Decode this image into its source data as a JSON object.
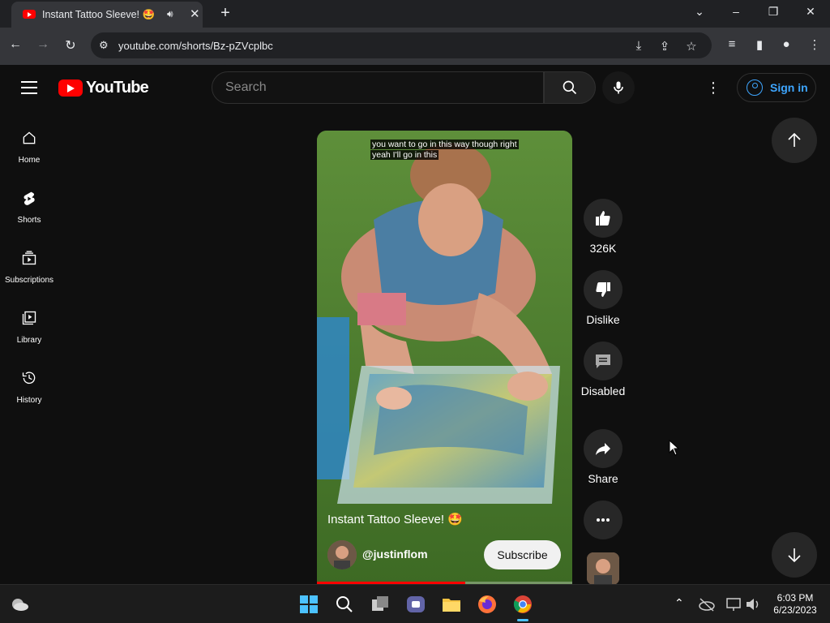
{
  "browser": {
    "tab_title": "Instant Tattoo Sleeve! 🤩",
    "url": "youtube.com/shorts/Bz-pZVcplbc"
  },
  "header": {
    "logo_text": "YouTube",
    "search_placeholder": "Search",
    "sign_in": "Sign in"
  },
  "sidebar": {
    "items": [
      {
        "label": "Home",
        "icon": "home-icon"
      },
      {
        "label": "Shorts",
        "icon": "shorts-icon"
      },
      {
        "label": "Subscriptions",
        "icon": "subscriptions-icon"
      },
      {
        "label": "Library",
        "icon": "library-icon"
      },
      {
        "label": "History",
        "icon": "history-icon"
      }
    ]
  },
  "video": {
    "caption_line1": "you want to go in this way though right",
    "caption_line2": "yeah I'll go in this",
    "title": "Instant Tattoo Sleeve! 🤩",
    "channel_handle": "@justinflom",
    "subscribe_label": "Subscribe",
    "progress": 0.58
  },
  "actions": {
    "like_count": "326K",
    "dislike_label": "Dislike",
    "comments_label": "Disabled",
    "share_label": "Share"
  },
  "taskbar": {
    "time": "6:03 PM",
    "date": "6/23/2023"
  },
  "colors": {
    "accent_blue": "#3ea6ff",
    "youtube_red": "#ff0000",
    "background": "#0f0f0f"
  }
}
